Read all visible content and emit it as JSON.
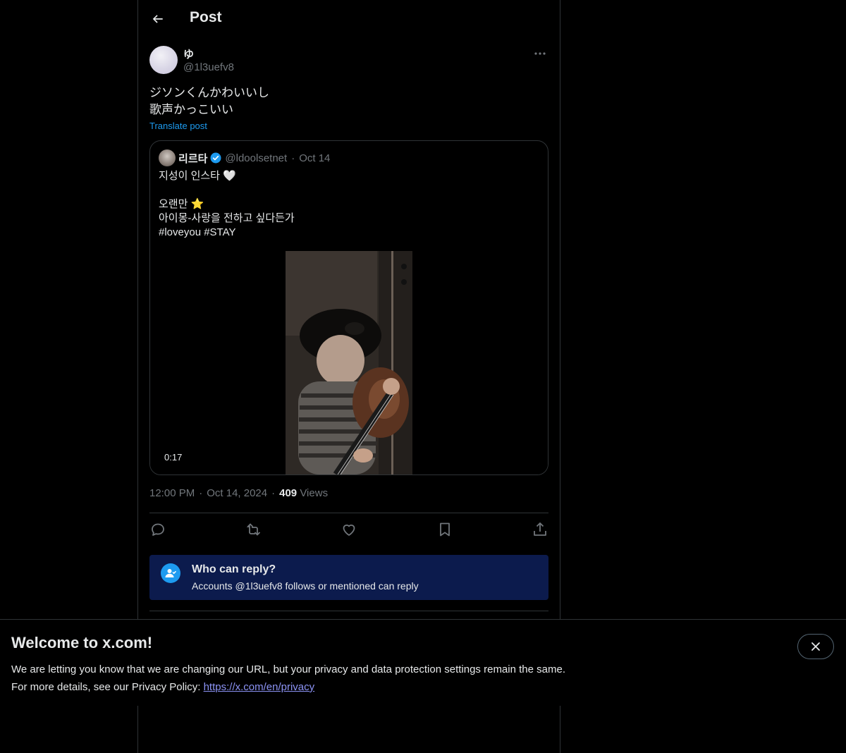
{
  "header": {
    "title": "Post",
    "back_icon": "arrow-left-icon"
  },
  "post": {
    "author_name": "ゆ",
    "author_handle": "@1l3uefv8",
    "text_line1": "ジソンくんかわいいし",
    "text_line2": "歌声かっこいい",
    "translate_label": "Translate post",
    "timestamp": "12:00 PM",
    "date": "Oct 14, 2024",
    "views_count": "409",
    "views_label": "Views",
    "separator": "·"
  },
  "quote": {
    "name": "리르타",
    "verified": true,
    "handle": "@ldoolsetnet",
    "separator": "·",
    "date": "Oct 14",
    "text": "지성이 인스타 🤍\n\n오랜만 ⭐️\n아이몽-사랑을 전하고 싶다든가\n#loveyou #STAY",
    "video_duration": "0:17"
  },
  "actions": [
    "reply-icon",
    "repost-icon",
    "like-icon",
    "bookmark-icon",
    "share-icon"
  ],
  "reply_notice": {
    "title": "Who can reply?",
    "subtitle": "Accounts @1l3uefv8 follows or mentioned can reply"
  },
  "banner": {
    "title": "Welcome to x.com!",
    "line1": "We are letting you know that we are changing our URL, but your privacy and data protection settings remain the same.",
    "line2_prefix": "For more details, see our Privacy Policy: ",
    "link": "https://x.com/en/privacy"
  },
  "colors": {
    "background": "#000000",
    "text": "#e7e9ea",
    "muted": "#71767b",
    "accent": "#1d9bf0",
    "border": "#2f3336",
    "reply_box": "#0c1b4d",
    "link": "#8c93f5"
  }
}
